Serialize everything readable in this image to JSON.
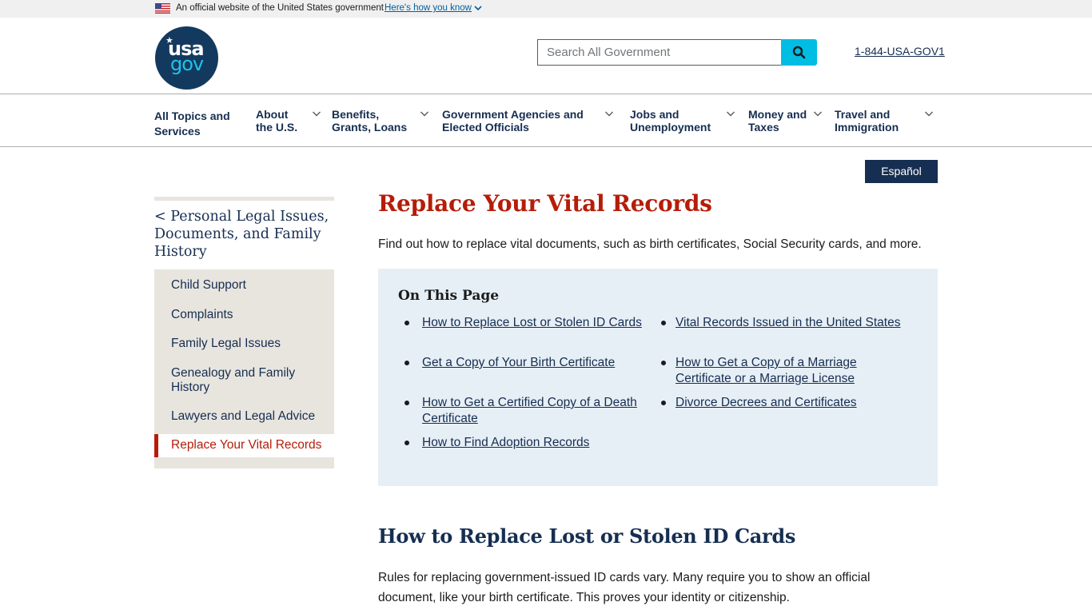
{
  "banner": {
    "official_text": "An official website of the United States government",
    "how_link": "Here's how you know"
  },
  "header": {
    "logo_top": "usa",
    "logo_bottom": "gov",
    "search_placeholder": "Search All Government",
    "search_value": "",
    "phone": "1-844-USA-GOV1"
  },
  "nav": {
    "items": [
      {
        "label_line1": "All Topics and",
        "label_line2": "Services",
        "has_dropdown": false
      },
      {
        "label_line1": "About",
        "label_line2": "the U.S.",
        "has_dropdown": true
      },
      {
        "label_line1": "Benefits,",
        "label_line2": "Grants, Loans",
        "has_dropdown": true
      },
      {
        "label_line1": "Government Agencies and",
        "label_line2": "Elected Officials",
        "has_dropdown": true
      },
      {
        "label_line1": "Jobs and",
        "label_line2": "Unemployment",
        "has_dropdown": true
      },
      {
        "label_line1": "Money and",
        "label_line2": "Taxes",
        "has_dropdown": true
      },
      {
        "label_line1": "Travel and",
        "label_line2": "Immigration",
        "has_dropdown": true
      }
    ]
  },
  "language_button": "Español",
  "sidebar": {
    "parent": "< Personal Legal Issues, Documents, and Family History",
    "items": [
      {
        "label": "Child Support"
      },
      {
        "label": "Complaints"
      },
      {
        "label": "Family Legal Issues"
      },
      {
        "label": "Genealogy and Family History"
      },
      {
        "label": "Lawyers and Legal Advice"
      }
    ],
    "active_item": "Replace Your Vital Records"
  },
  "main": {
    "title": "Replace Your Vital Records",
    "intro": "Find out how to replace vital documents, such as birth certificates, Social Security cards, and more.",
    "on_this_page": {
      "title": "On This Page",
      "left_links": [
        "How to Replace Lost or Stolen ID Cards ",
        "Get a Copy of Your Birth Certificate",
        "How to Get a Certified Copy of a Death Certificate",
        "How to Find Adoption Records"
      ],
      "right_links": [
        "Vital Records Issued in the United States",
        "How to Get a Copy of a Marriage Certificate or a Marriage License",
        "Divorce Decrees and Certificates"
      ]
    },
    "section_heading": "How to Replace Lost or Stolen ID Cards",
    "section_text": "Rules for replacing government-issued ID cards vary. Many require you to show an official document, like your birth certificate. This proves your identity or citizenship."
  },
  "colors": {
    "primary_dark": "#162e51",
    "accent_red": "#b51d09",
    "search_button": "#00bde3",
    "sidebar_bg": "#e8e5df",
    "on_this_page_bg": "#e7eff6"
  }
}
